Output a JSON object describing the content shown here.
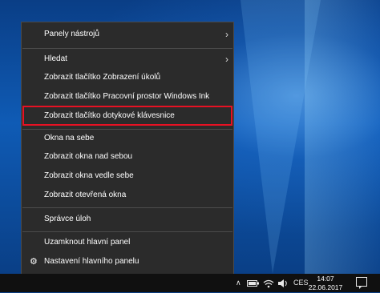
{
  "menu": {
    "item_toolbars": "Panely nástrojů",
    "item_search": "Hledat",
    "item_task_view": "Zobrazit tlačítko Zobrazení úkolů",
    "item_ink": "Zobrazit tlačítko Pracovní prostor Windows Ink",
    "item_touch_keyboard": "Zobrazit tlačítko dotykové klávesnice",
    "item_cascade": "Okna na sebe",
    "item_stacked": "Zobrazit okna nad sebou",
    "item_side_by_side": "Zobrazit okna vedle sebe",
    "item_show_desktop": "Zobrazit otevřená okna",
    "item_task_manager": "Správce úloh",
    "item_lock_taskbar": "Uzamknout hlavní panel",
    "item_settings": "Nastavení hlavního panelu",
    "submenu_arrow": "›",
    "settings_icon": "gear-icon",
    "highlight_color": "#e81123"
  },
  "taskbar": {
    "chevron": "∧",
    "language": "CES",
    "time": "14:07",
    "date": "22.06.2017",
    "icons": [
      "chevron-up-icon",
      "battery-icon",
      "wifi-icon",
      "volume-icon",
      "notification-icon"
    ]
  }
}
